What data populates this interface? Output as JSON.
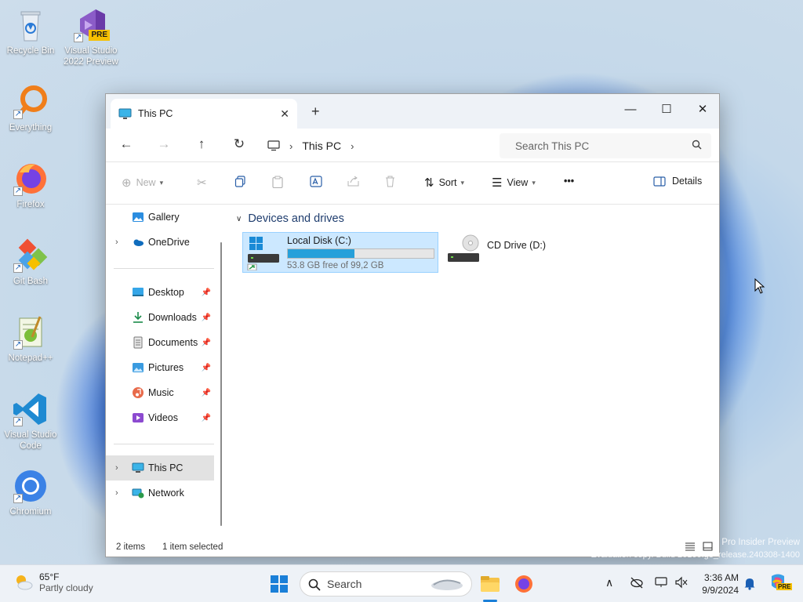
{
  "desktop": {
    "icons": [
      {
        "label": "Recycle Bin"
      },
      {
        "label": "Visual Studio 2022 Preview",
        "badge": "PRE"
      },
      {
        "label": "Everything"
      },
      {
        "label": "Firefox"
      },
      {
        "label": "Git Bash"
      },
      {
        "label": "Notepad++"
      },
      {
        "label": "Visual Studio Code"
      },
      {
        "label": "Chromium"
      }
    ],
    "watermark_line1": "Pro Insider Preview",
    "watermark_line2": "Evaluation copy. Build 26100.ge_release.240308-1400"
  },
  "window": {
    "tab_title": "This PC",
    "close_tab": "✕",
    "new_tab": "+",
    "controls": {
      "minimize": "—",
      "maximize": "☐",
      "close": "✕"
    },
    "address": {
      "back": "←",
      "forward": "→",
      "up": "↑",
      "refresh": "↻",
      "crumb_sep": "›",
      "crumb": "This PC",
      "search_placeholder": "Search This PC"
    },
    "toolbar": {
      "new": "New",
      "sort": "Sort",
      "view": "View",
      "more": "•••",
      "details": "Details"
    },
    "nav": {
      "items": [
        {
          "label": "Gallery"
        },
        {
          "label": "OneDrive",
          "expandable": true
        },
        {
          "label": "Desktop",
          "pinned": true
        },
        {
          "label": "Downloads",
          "pinned": true
        },
        {
          "label": "Documents",
          "pinned": true
        },
        {
          "label": "Pictures",
          "pinned": true
        },
        {
          "label": "Music",
          "pinned": true
        },
        {
          "label": "Videos",
          "pinned": true
        },
        {
          "label": "This PC",
          "expandable": true,
          "selected": true
        },
        {
          "label": "Network",
          "expandable": true
        }
      ]
    },
    "content": {
      "group_title": "Devices and drives",
      "drives": [
        {
          "name": "Local Disk (C:)",
          "free_text": "53.8 GB free of 99,2 GB",
          "used_fraction": 0.457,
          "selected": true
        },
        {
          "name": "CD Drive (D:)"
        }
      ]
    },
    "status": {
      "items": "2 items",
      "selected": "1 item selected"
    }
  },
  "taskbar": {
    "weather_temp": "65°F",
    "weather_desc": "Partly cloudy",
    "search_label": "Search",
    "time": "3:36 AM",
    "date": "9/9/2024",
    "copilot_badge": "PRE"
  },
  "colors": {
    "accent": "#26a0da",
    "selection": "#cce8ff",
    "nav_selected": "#e2e2e2"
  }
}
